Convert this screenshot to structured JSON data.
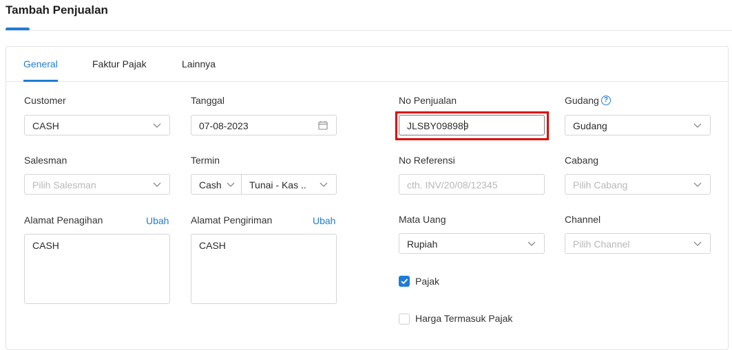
{
  "page": {
    "title": "Tambah Penjualan"
  },
  "tabs": [
    {
      "label": "General",
      "active": true
    },
    {
      "label": "Faktur Pajak",
      "active": false
    },
    {
      "label": "Lainnya",
      "active": false
    }
  ],
  "form": {
    "customer": {
      "label": "Customer",
      "value": "CASH"
    },
    "tanggal": {
      "label": "Tanggal",
      "value": "07-08-2023"
    },
    "no_penjualan": {
      "label": "No Penjualan",
      "value": "JLSBY098989"
    },
    "gudang": {
      "label": "Gudang",
      "value": "Gudang",
      "help": "?"
    },
    "salesman": {
      "label": "Salesman",
      "placeholder": "Pilih Salesman"
    },
    "termin": {
      "label": "Termin",
      "type_value": "Cash",
      "value": "Tunai - Kas .."
    },
    "no_referensi": {
      "label": "No Referensi",
      "placeholder": "cth. INV/20/08/12345"
    },
    "cabang": {
      "label": "Cabang",
      "placeholder": "Pilih Cabang"
    },
    "alamat_penagihan": {
      "label": "Alamat Penagihan",
      "link": "Ubah",
      "value": "CASH"
    },
    "alamat_pengiriman": {
      "label": "Alamat Pengiriman",
      "link": "Ubah",
      "value": "CASH"
    },
    "mata_uang": {
      "label": "Mata Uang",
      "value": "Rupiah"
    },
    "channel": {
      "label": "Channel",
      "placeholder": "Pilih Channel"
    },
    "pajak": {
      "label": "Pajak",
      "checked": true
    },
    "harga_termasuk_pajak": {
      "label": "Harga Termasuk Pajak",
      "checked": false
    }
  },
  "colors": {
    "accent": "#1e7cd6",
    "highlight": "#e00000"
  }
}
